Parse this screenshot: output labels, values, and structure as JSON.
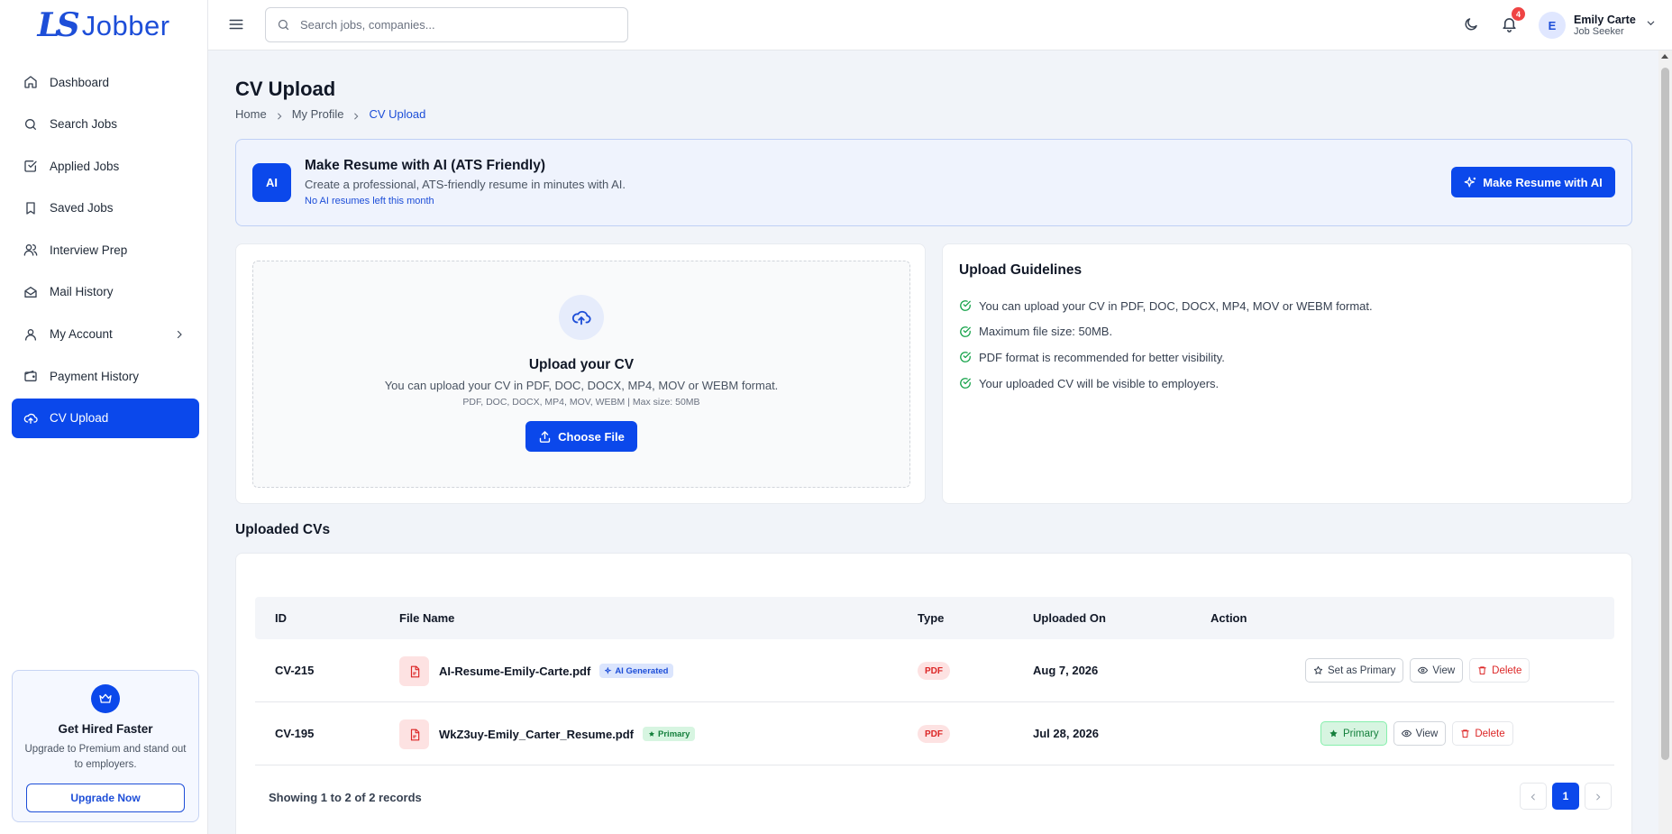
{
  "brand": {
    "mark": "LS",
    "name": "Jobber",
    "color": "#1d4ed8"
  },
  "sidebar": {
    "items": [
      {
        "label": "Dashboard",
        "icon": "home-icon"
      },
      {
        "label": "Search Jobs",
        "icon": "search-icon"
      },
      {
        "label": "Applied Jobs",
        "icon": "checkbox-icon"
      },
      {
        "label": "Saved Jobs",
        "icon": "bookmark-icon"
      },
      {
        "label": "Interview Prep",
        "icon": "people-icon"
      },
      {
        "label": "Mail History",
        "icon": "mail-open-icon"
      },
      {
        "label": "My Account",
        "icon": "user-icon"
      },
      {
        "label": "Payment History",
        "icon": "wallet-icon"
      },
      {
        "label": "CV Upload",
        "icon": "cloud-upload-icon",
        "active": true
      }
    ],
    "promo": {
      "title": "Get Hired Faster",
      "text": "Upgrade to Premium and stand out to employers.",
      "button": "Upgrade Now"
    }
  },
  "topbar": {
    "search_placeholder": "Search jobs, companies...",
    "notifications_count": "4",
    "user": {
      "initial": "E",
      "name": "Emily Carte",
      "role": "Job Seeker"
    }
  },
  "page": {
    "title": "CV Upload",
    "breadcrumb": [
      "Home",
      "My Profile",
      "CV Upload"
    ]
  },
  "ai_card": {
    "badge": "AI",
    "title": "Make Resume with AI (ATS Friendly)",
    "description": "Create a professional, ATS-friendly resume in minutes with AI.",
    "warning": "No AI resumes left this month",
    "button": "Make Resume with AI"
  },
  "upload": {
    "title": "Upload your CV",
    "description": "You can upload your CV in PDF, DOC, DOCX, MP4, MOV or WEBM format.",
    "hint": "PDF, DOC, DOCX, MP4, MOV, WEBM | Max size: 50MB",
    "button": "Choose File"
  },
  "guidelines": {
    "title": "Upload Guidelines",
    "items": [
      "You can upload your CV in PDF, DOC, DOCX, MP4, MOV or WEBM format.",
      "Maximum file size: 50MB.",
      "PDF format is recommended for better visibility.",
      "Your uploaded CV will be visible to employers."
    ]
  },
  "cv_list": {
    "title": "Uploaded CVs",
    "columns": [
      "ID",
      "File Name",
      "Type",
      "Uploaded On",
      "Action"
    ],
    "rows": [
      {
        "id": "CV-215",
        "file_name": "AI-Resume-Emily-Carte.pdf",
        "tag": "AI Generated",
        "type": "PDF",
        "uploaded_on": "Aug 7, 2026",
        "actions": [
          "Set as Primary",
          "View",
          "Delete"
        ]
      },
      {
        "id": "CV-195",
        "file_name": "WkZ3uy-Emily_Carter_Resume.pdf",
        "tag": "Primary",
        "type": "PDF",
        "uploaded_on": "Jul 28, 2026",
        "actions": [
          "Primary",
          "View",
          "Delete"
        ]
      }
    ],
    "footer": "Showing 1 to 2 of 2 records",
    "pagination": {
      "current": "1"
    }
  }
}
